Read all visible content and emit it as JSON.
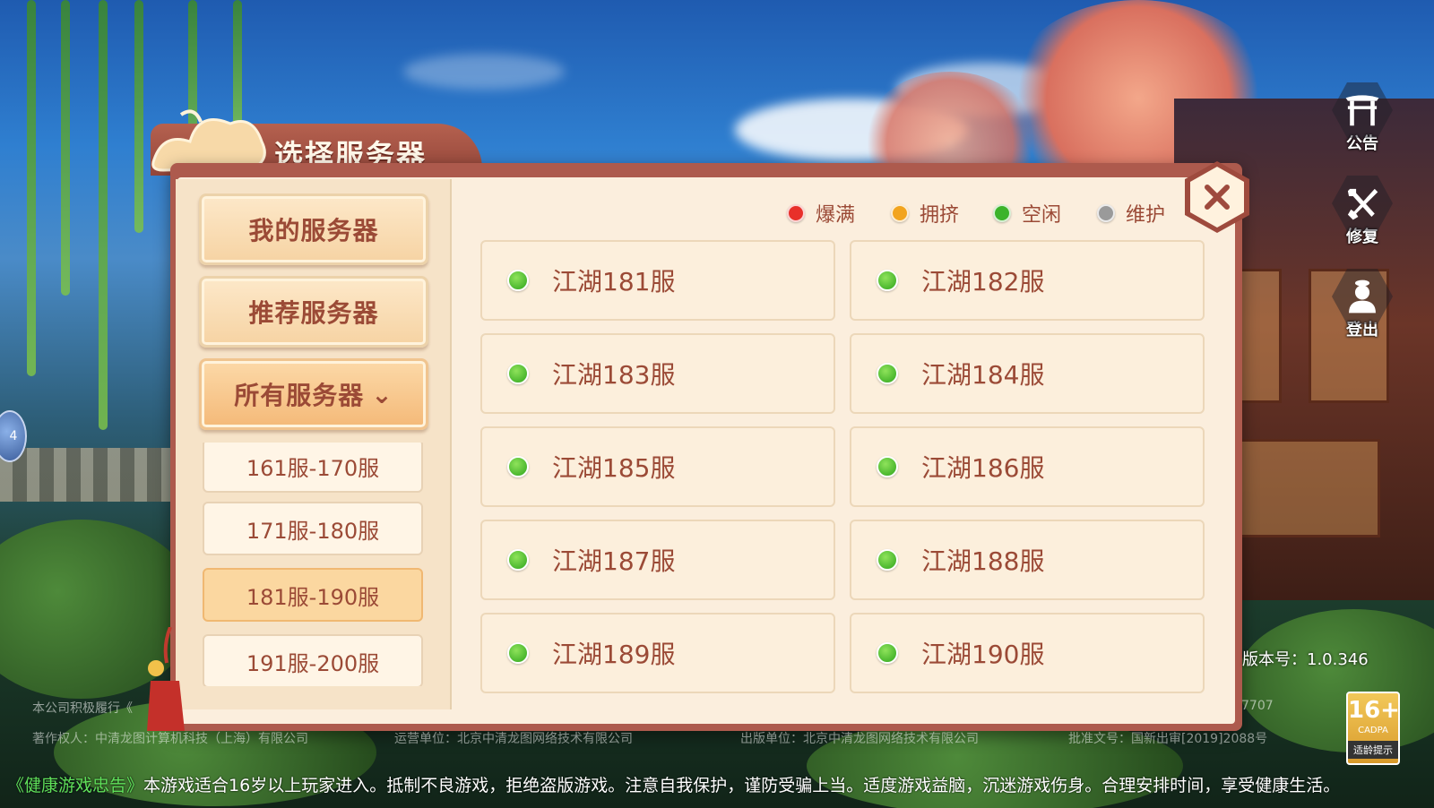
{
  "panel": {
    "title": "选择服务器"
  },
  "tabs": [
    {
      "label": "我的服务器"
    },
    {
      "label": "推荐服务器"
    },
    {
      "label": "所有服务器",
      "active": true
    }
  ],
  "ranges": [
    {
      "label": "161服-170服"
    },
    {
      "label": "171服-180服"
    },
    {
      "label": "181服-190服",
      "selected": true
    },
    {
      "label": "191服-200服"
    }
  ],
  "legend": [
    {
      "label": "爆满",
      "color": "#e8302a"
    },
    {
      "label": "拥挤",
      "color": "#f2a41e"
    },
    {
      "label": "空闲",
      "color": "#3bb32a"
    },
    {
      "label": "维护",
      "color": "#9a9a9a"
    }
  ],
  "servers": [
    {
      "name": "江湖181服",
      "status": "空闲"
    },
    {
      "name": "江湖182服",
      "status": "空闲"
    },
    {
      "name": "江湖183服",
      "status": "空闲"
    },
    {
      "name": "江湖184服",
      "status": "空闲"
    },
    {
      "name": "江湖185服",
      "status": "空闲"
    },
    {
      "name": "江湖186服",
      "status": "空闲"
    },
    {
      "name": "江湖187服",
      "status": "空闲"
    },
    {
      "name": "江湖188服",
      "status": "空闲"
    },
    {
      "name": "江湖189服",
      "status": "空闲"
    },
    {
      "name": "江湖190服",
      "status": "空闲"
    }
  ],
  "side_buttons": [
    {
      "label": "公告",
      "icon": "gate-icon"
    },
    {
      "label": "修复",
      "icon": "repair-icon"
    },
    {
      "label": "登出",
      "icon": "logout-icon"
    }
  ],
  "float_ball": {
    "text": "4"
  },
  "footer": {
    "version": "版本号：1.0.346",
    "copyright_left": "本公司积极履行《",
    "copyright_right": "7707",
    "copyright_owner": "著作权人：中清龙图计算机科技（上海）有限公司",
    "operator": "运营单位：北京中清龙图网络技术有限公司",
    "publisher": "出版单位：北京中清龙图网络技术有限公司",
    "approval": "批准文号：国新出审[2019]2088号",
    "health_title": "《健康游戏忠告》",
    "health_text": "本游戏适合16岁以上玩家进入。抵制不良游戏，拒绝盗版游戏。注意自我保护，谨防受骗上当。适度游戏益脑，沉迷游戏伤身。合理安排时间，享受健康生活。",
    "age_rating": "16+",
    "age_org": "CADPA",
    "age_tip": "适龄提示"
  }
}
